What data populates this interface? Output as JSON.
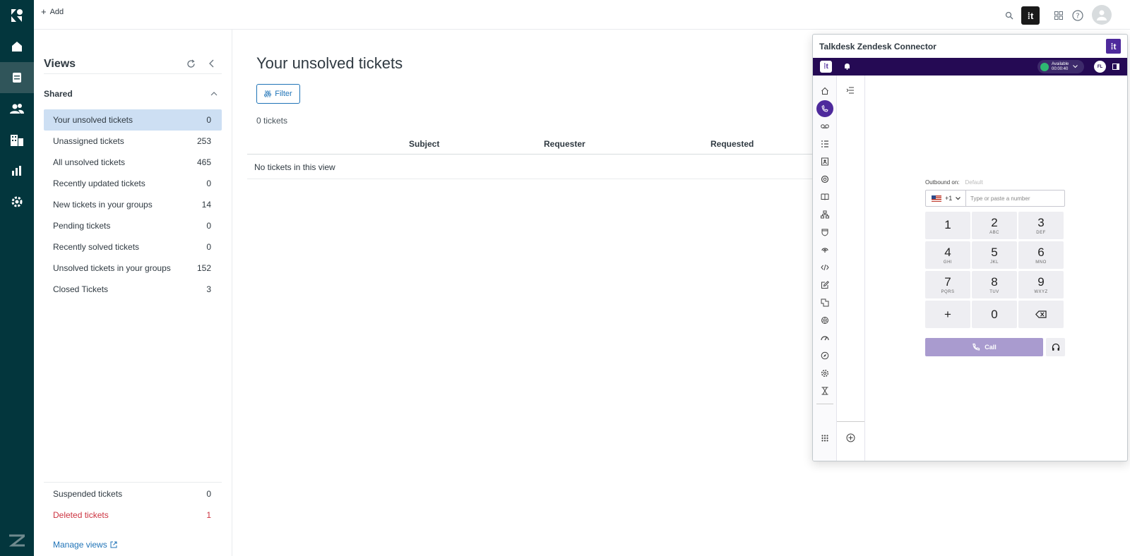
{
  "topbar": {
    "add_label": "Add"
  },
  "views": {
    "title": "Views",
    "shared_label": "Shared",
    "items": [
      {
        "label": "Your unsolved tickets",
        "count": "0"
      },
      {
        "label": "Unassigned tickets",
        "count": "253"
      },
      {
        "label": "All unsolved tickets",
        "count": "465"
      },
      {
        "label": "Recently updated tickets",
        "count": "0"
      },
      {
        "label": "New tickets in your groups",
        "count": "14"
      },
      {
        "label": "Pending tickets",
        "count": "0"
      },
      {
        "label": "Recently solved tickets",
        "count": "0"
      },
      {
        "label": "Unsolved tickets in your groups",
        "count": "152"
      },
      {
        "label": "Closed Tickets",
        "count": "3"
      }
    ],
    "suspended": {
      "label": "Suspended tickets",
      "count": "0"
    },
    "deleted": {
      "label": "Deleted tickets",
      "count": "1"
    },
    "manage_label": "Manage views"
  },
  "main": {
    "title": "Your unsolved tickets",
    "filter_label": "Filter",
    "count_text": "0 tickets",
    "columns": [
      "Subject",
      "Requester",
      "Requested"
    ],
    "empty_text": "No tickets in this view"
  },
  "talkdesk": {
    "title": "Talkdesk Zendesk Connector",
    "status_label": "Available",
    "status_timer": "00:00:40",
    "avatar_initials": "FL",
    "outbound_label": "Outbound on:",
    "outbound_value": "Default",
    "country_code": "+1",
    "number_placeholder": "Type or paste a number",
    "keys": [
      {
        "digit": "1",
        "letters": ""
      },
      {
        "digit": "2",
        "letters": "ABC"
      },
      {
        "digit": "3",
        "letters": "DEF"
      },
      {
        "digit": "4",
        "letters": "GHI"
      },
      {
        "digit": "5",
        "letters": "JKL"
      },
      {
        "digit": "6",
        "letters": "MNO"
      },
      {
        "digit": "7",
        "letters": "PQRS"
      },
      {
        "digit": "8",
        "letters": "TUV"
      },
      {
        "digit": "9",
        "letters": "WXYZ"
      },
      {
        "digit": "+",
        "letters": ""
      },
      {
        "digit": "0",
        "letters": ""
      }
    ],
    "call_label": "Call"
  },
  "colors": {
    "rail": "#03363d",
    "accent": "#1f73b7",
    "talkdesk_purple": "#4e2a9c",
    "danger": "#cc3340"
  }
}
